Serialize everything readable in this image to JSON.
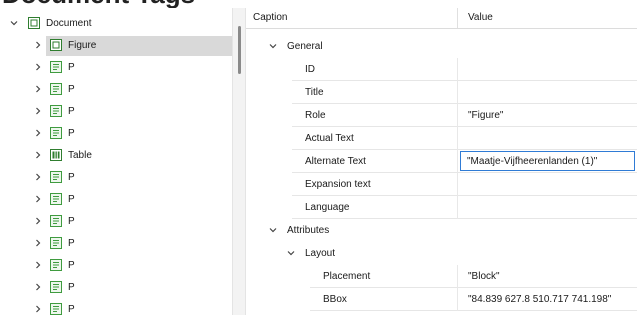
{
  "tree": {
    "items": [
      {
        "label": "Document",
        "icon": "document-icon",
        "expanded": true
      },
      {
        "label": "Figure",
        "icon": "figure-icon",
        "selected": true
      },
      {
        "label": "P",
        "icon": "paragraph-icon"
      },
      {
        "label": "P",
        "icon": "paragraph-icon"
      },
      {
        "label": "P",
        "icon": "paragraph-icon"
      },
      {
        "label": "P",
        "icon": "paragraph-icon"
      },
      {
        "label": "Table",
        "icon": "table-icon"
      },
      {
        "label": "P",
        "icon": "paragraph-icon"
      },
      {
        "label": "P",
        "icon": "paragraph-icon"
      },
      {
        "label": "P",
        "icon": "paragraph-icon"
      },
      {
        "label": "P",
        "icon": "paragraph-icon"
      },
      {
        "label": "P",
        "icon": "paragraph-icon"
      },
      {
        "label": "P",
        "icon": "paragraph-icon"
      },
      {
        "label": "P",
        "icon": "paragraph-icon"
      }
    ]
  },
  "grid": {
    "header": {
      "caption": "Caption",
      "value": "Value"
    },
    "rows": [
      {
        "caption": "General",
        "value": "",
        "group": true
      },
      {
        "caption": "ID",
        "value": ""
      },
      {
        "caption": "Title",
        "value": ""
      },
      {
        "caption": "Role",
        "value": "\"Figure\""
      },
      {
        "caption": "Actual Text",
        "value": ""
      },
      {
        "caption": "Alternate Text",
        "value": "\"Maatje-Vijfheerenlanden (1)\"",
        "editing": true
      },
      {
        "caption": "Expansion text",
        "value": ""
      },
      {
        "caption": "Language",
        "value": ""
      },
      {
        "caption": "Attributes",
        "value": "",
        "group": true
      },
      {
        "caption": "Layout",
        "value": "",
        "group": true
      },
      {
        "caption": "Placement",
        "value": "\"Block\""
      },
      {
        "caption": "BBox",
        "value": "\"84.839 627.8 510.717 741.198\""
      }
    ]
  },
  "colors": {
    "selection": "#d9d9d9",
    "edit_border": "#2f7bd5",
    "icon_green": "#3f9b3f"
  }
}
